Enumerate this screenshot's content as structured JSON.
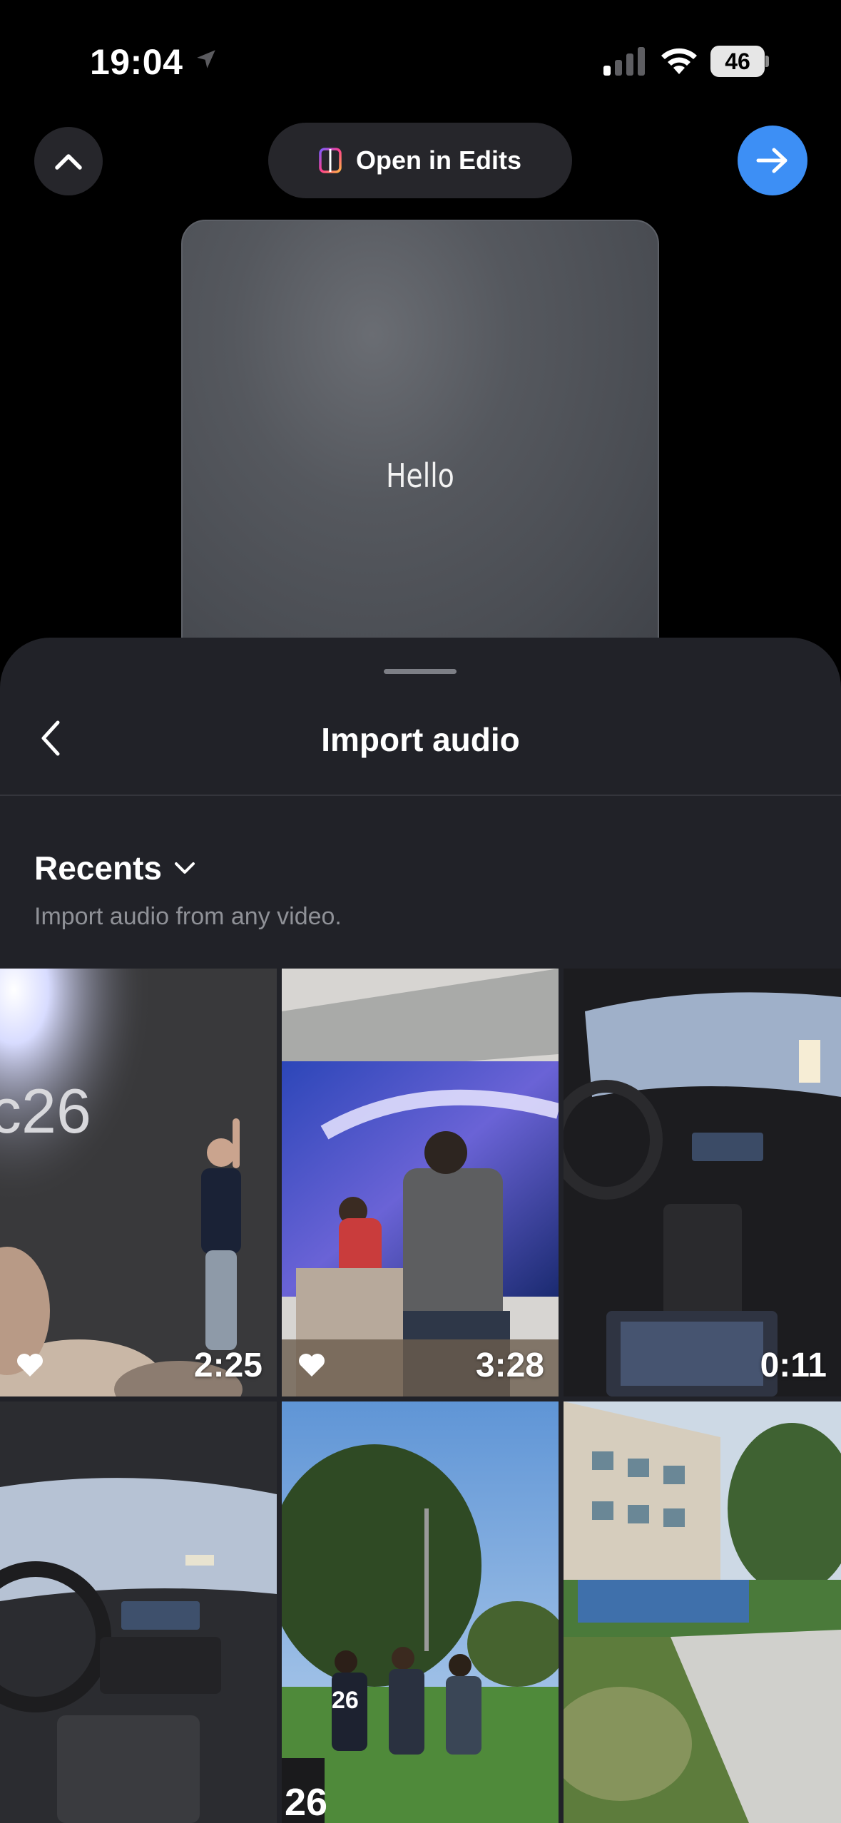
{
  "status": {
    "time": "19:04",
    "battery": "46"
  },
  "top": {
    "open_in_edits": "Open in Edits"
  },
  "preview": {
    "text": "Hello"
  },
  "sheet": {
    "title": "Import audio",
    "recents_label": "Recents",
    "subtitle": "Import audio from any video."
  },
  "videos": [
    {
      "duration": "2:25",
      "favorite": true
    },
    {
      "duration": "3:28",
      "favorite": true
    },
    {
      "duration": "0:11",
      "favorite": false
    },
    {
      "duration": "",
      "favorite": false
    },
    {
      "duration": "",
      "favorite": false
    },
    {
      "duration": "",
      "favorite": false
    }
  ],
  "colors": {
    "accent": "#3d8ff5",
    "sheet": "#212228",
    "pill": "#26262b"
  }
}
